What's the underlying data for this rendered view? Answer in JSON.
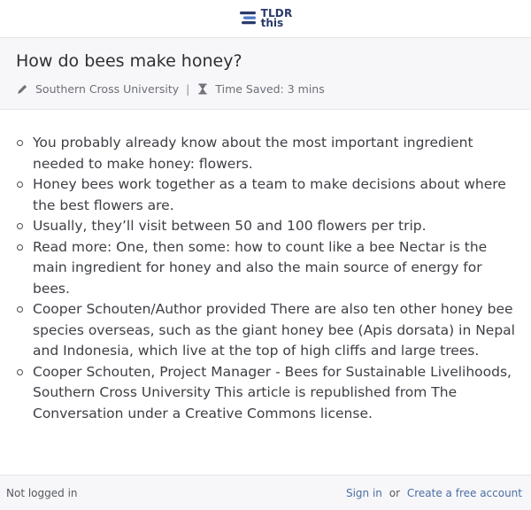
{
  "brand": {
    "logo_line1": "TLDR",
    "logo_line2": "this",
    "accent": "#2a3a6b",
    "accent_light": "#4b78c8"
  },
  "article": {
    "title": "How do bees make honey?",
    "source": "Southern Cross University",
    "separator": "|",
    "time_saved": "Time Saved: 3 mins"
  },
  "summary": [
    "You probably already know about the most important ingredient needed to make honey: flowers.",
    "Honey bees work together as a team to make decisions about where the best flowers are.",
    "Usually, they’ll visit between 50 and 100 flowers per trip.",
    "Read more: One, then some: how to count like a bee Nectar is the main ingredient for honey and also the main source of energy for bees.",
    "Cooper Schouten/Author provided There are also ten other honey bee species overseas, such as the giant honey bee (Apis dorsata) in Nepal and Indonesia, which live at the top of high cliffs and large trees.",
    "Cooper Schouten, Project Manager - Bees for Sustainable Livelihoods, Southern Cross University This article is republished from The Conversation under a Creative Commons license."
  ],
  "footer": {
    "status": "Not logged in",
    "sign_in": "Sign in",
    "or": "or",
    "create_account": "Create a free account"
  },
  "icons": {
    "author": "pencil-icon",
    "time": "hourglass-icon",
    "bullet": "hollow-circle"
  }
}
